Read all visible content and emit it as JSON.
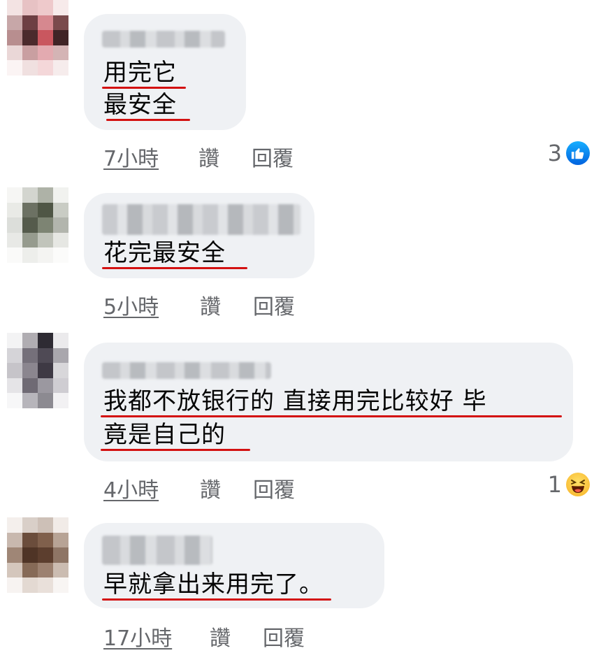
{
  "comments": [
    {
      "lines": [
        "用完它",
        "最安全"
      ],
      "time": "7小時",
      "like_label": "讚",
      "reply_label": "回覆",
      "reaction": {
        "count": "3",
        "icon": "like-icon"
      }
    },
    {
      "lines": [
        "花完最安全"
      ],
      "time": "5小時",
      "like_label": "讚",
      "reply_label": "回覆",
      "reaction": null
    },
    {
      "lines": [
        "我都不放银行的 直接用完比较好 毕",
        "竟是自己的"
      ],
      "time": "4小時",
      "like_label": "讚",
      "reply_label": "回覆",
      "reaction": {
        "count": "1",
        "icon": "haha-icon"
      }
    },
    {
      "lines": [
        "早就拿出来用完了",
        "。"
      ],
      "time": "17小時",
      "like_label": "讚",
      "reply_label": "回覆",
      "reaction": null
    }
  ],
  "colors": {
    "bubble": "#eff1f4",
    "underline": "#d31111",
    "meta_text": "#65676b",
    "like_blue": "#0866ff"
  }
}
